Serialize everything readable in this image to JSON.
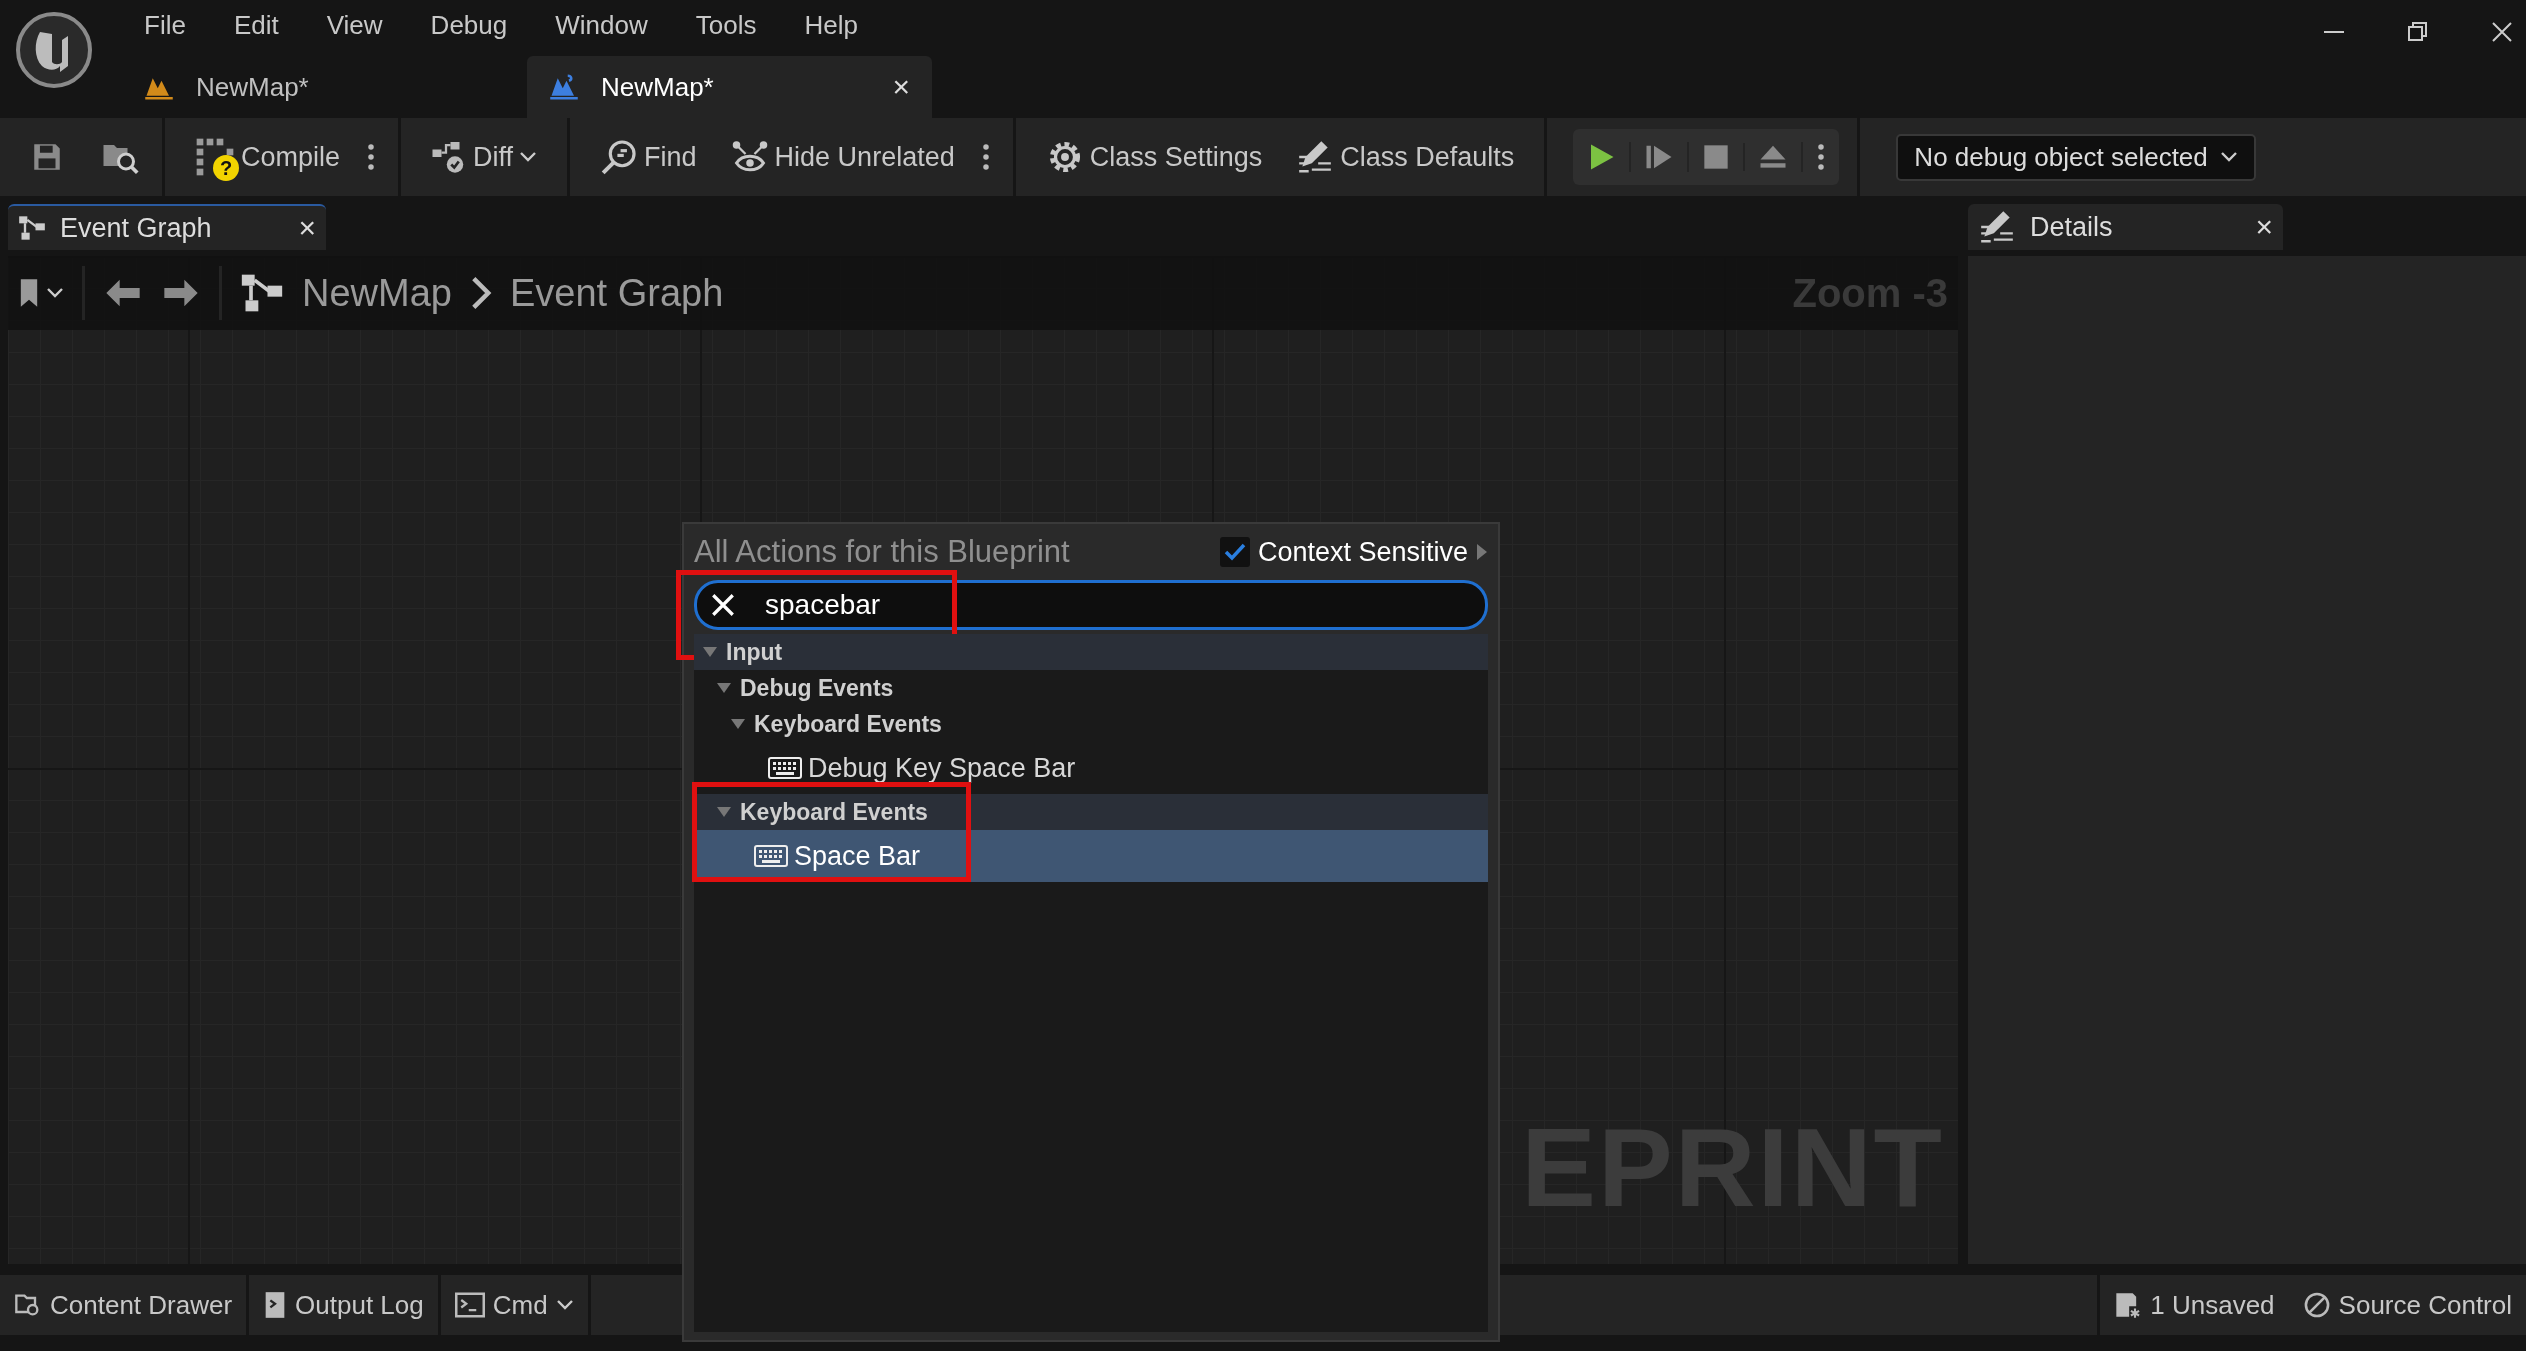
{
  "menu": [
    "File",
    "Edit",
    "View",
    "Debug",
    "Window",
    "Tools",
    "Help"
  ],
  "document_tabs": [
    {
      "label": "NewMap*",
      "kind": "level",
      "selected": false
    },
    {
      "label": "NewMap*",
      "kind": "blueprint",
      "selected": true,
      "close": "×"
    }
  ],
  "toolbar": [
    [
      {
        "kind": "save"
      },
      {
        "kind": "browse"
      }
    ],
    [
      {
        "kind": "compile",
        "label": "Compile",
        "badge": "?",
        "more": true
      }
    ],
    [
      {
        "kind": "diff",
        "label": "Diff",
        "dropdown": true
      }
    ],
    [
      {
        "kind": "find",
        "label": "Find"
      },
      {
        "kind": "hide",
        "label": "Hide Unrelated",
        "more": true
      }
    ],
    [
      {
        "kind": "settings",
        "label": "Class Settings"
      },
      {
        "kind": "defaults",
        "label": "Class Defaults"
      }
    ]
  ],
  "play_controls": [
    {
      "kind": "play"
    },
    {
      "kind": "step"
    },
    {
      "kind": "stop"
    },
    {
      "kind": "eject"
    },
    {
      "kind": "more"
    }
  ],
  "debug_object": {
    "value": "No debug object selected"
  },
  "graph_tab": {
    "label": "Event Graph",
    "close": "×"
  },
  "breadcrumb": [
    "NewMap",
    "Event Graph"
  ],
  "zoom": "Zoom -3",
  "watermark": "EPRINT",
  "details_tab": {
    "label": "Details",
    "close": "×"
  },
  "action_menu": {
    "title": "All Actions for this Blueprint",
    "context_sensitive": {
      "label": "Context Sensitive",
      "checked": true
    },
    "search": {
      "value": "spacebar",
      "highlighted": true
    },
    "tree": [
      {
        "label": "Input",
        "kind": "category",
        "expanded": true,
        "highlighted": false,
        "children": [
          {
            "label": "Debug Events",
            "kind": "category",
            "expanded": true,
            "highlighted": false,
            "children": [
              {
                "label": "Keyboard Events",
                "kind": "category",
                "expanded": true,
                "highlighted": false,
                "children": [
                  {
                    "label": "Debug Key Space Bar",
                    "kind": "action",
                    "selected": false
                  }
                ]
              }
            ]
          },
          {
            "label": "Keyboard Events",
            "kind": "category",
            "expanded": true,
            "highlighted": true,
            "children": [
              {
                "label": "Space Bar",
                "kind": "action",
                "selected": true
              }
            ]
          }
        ]
      }
    ]
  },
  "status_bar": {
    "left": [
      {
        "kind": "drawer",
        "label": "Content Drawer"
      },
      {
        "kind": "log",
        "label": "Output Log"
      },
      {
        "kind": "cmd",
        "label": "Cmd",
        "dropdown": true
      }
    ],
    "right": [
      {
        "kind": "unsaved",
        "label": "1 Unsaved"
      },
      {
        "kind": "source",
        "label": "Source Control"
      }
    ]
  }
}
